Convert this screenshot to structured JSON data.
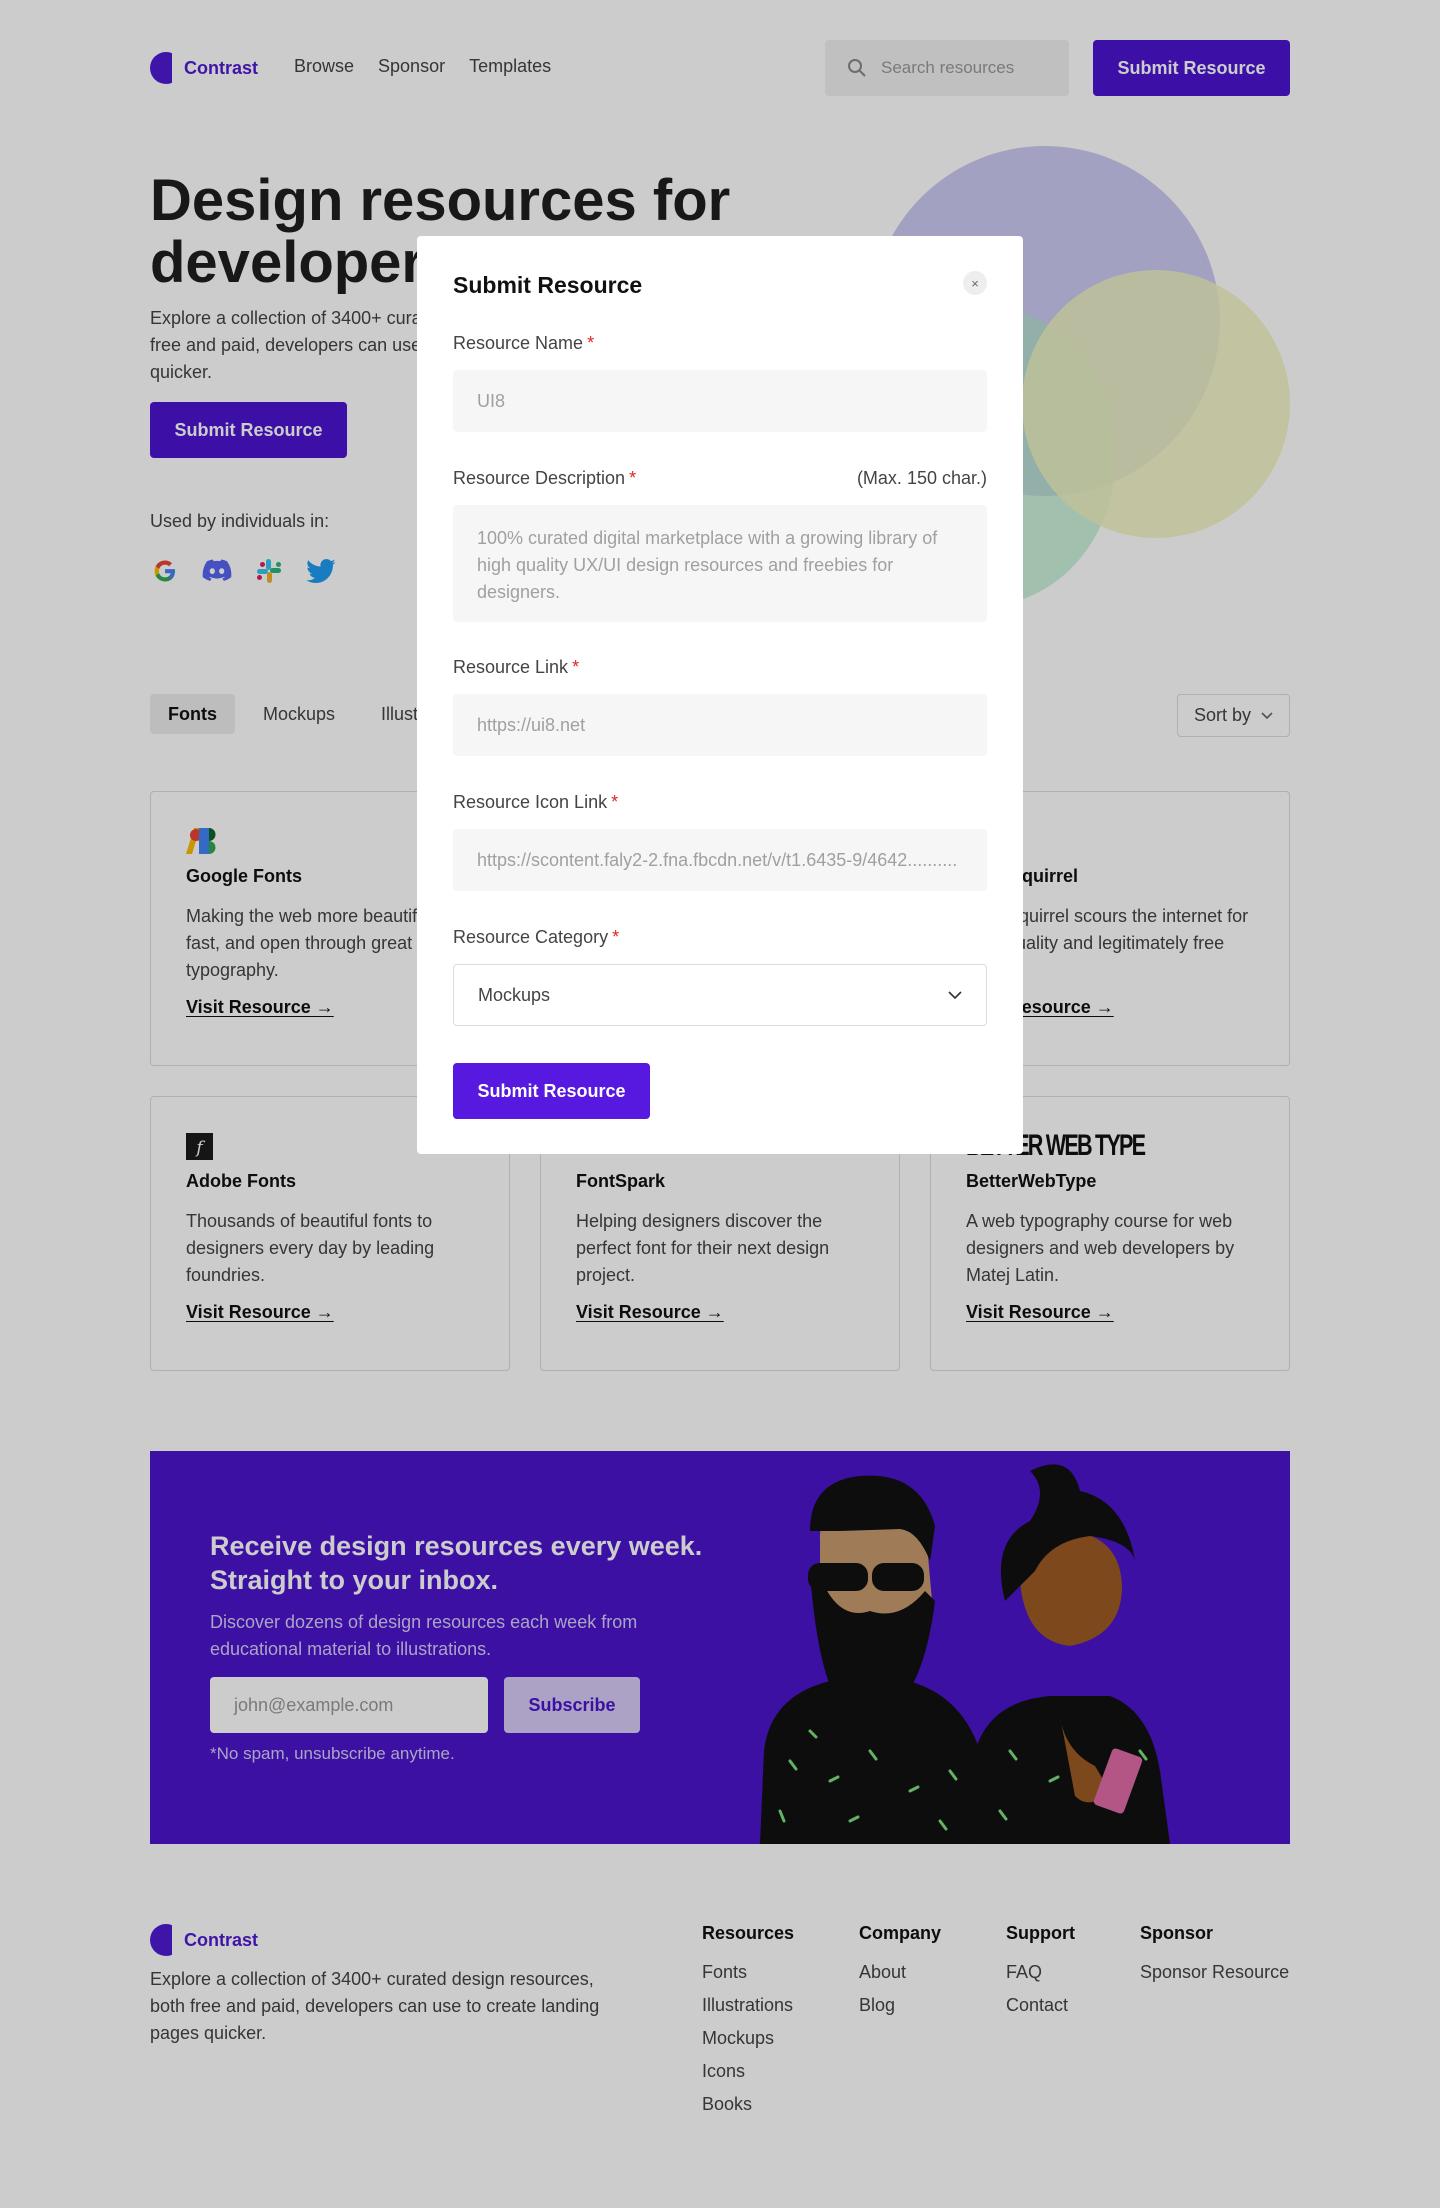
{
  "header": {
    "brand": "Contrast",
    "nav": [
      "Browse",
      "Sponsor",
      "Templates"
    ],
    "search_placeholder": "Search resources",
    "submit_label": "Submit Resource"
  },
  "hero": {
    "title": "Design resources for developers",
    "description": "Explore a collection of 3400+ curated design resources, both free and paid, developers can use to create landing pages quicker.",
    "button": "Submit Resource",
    "used_by": "Used by individuals in:",
    "brands": [
      "google-icon",
      "discord-icon",
      "slack-icon",
      "twitter-icon"
    ]
  },
  "filters": {
    "tabs": [
      "Fonts",
      "Mockups",
      "Illustrations"
    ],
    "active": "Fonts",
    "sort_label": "Sort by"
  },
  "cards": [
    {
      "title": "Google Fonts",
      "desc": "Making the web more beautiful, fast, and open through great typography.",
      "link": "Visit Resource →"
    },
    {
      "title": "",
      "desc": "",
      "link": ""
    },
    {
      "title": "Font Squirrel",
      "desc": "Font Squirrel scours the internet for high-quality and legitimately free fonts.",
      "link": "Visit Resource →"
    },
    {
      "title": "Adobe Fonts",
      "desc": "Thousands of beautiful fonts to designers every day by leading foundries.",
      "link": "Visit Resource →"
    },
    {
      "title": "FontSpark",
      "desc": "Helping designers discover the perfect font for their next design project.",
      "link": "Visit Resource →"
    },
    {
      "title": "BetterWebType",
      "desc": "A web typography course for web designers and web developers by Matej Latin.",
      "link": "Visit Resource →",
      "logo_text": "BETTER WEB TYPE"
    }
  ],
  "newsletter": {
    "title": "Receive design resources every week. Straight to your inbox.",
    "description": "Discover dozens of design resources each week from educational material to illustrations.",
    "email_placeholder": "john@example.com",
    "button": "Subscribe",
    "note": "*No spam, unsubscribe anytime."
  },
  "footer": {
    "brand": "Contrast",
    "description": "Explore a collection of 3400+ curated design resources, both free and paid, developers can use to create landing pages quicker.",
    "columns": [
      {
        "title": "Resources",
        "links": [
          "Fonts",
          "Illustrations",
          "Mockups",
          "Icons",
          "Books"
        ]
      },
      {
        "title": "Company",
        "links": [
          "About",
          "Blog"
        ]
      },
      {
        "title": "Support",
        "links": [
          "FAQ",
          "Contact"
        ]
      },
      {
        "title": "Sponsor",
        "links": [
          "Sponsor Resource"
        ]
      }
    ]
  },
  "modal": {
    "title": "Submit Resource",
    "close": "×",
    "required_mark": "*",
    "fields": {
      "name": {
        "label": "Resource Name",
        "placeholder": "UI8"
      },
      "description": {
        "label": "Resource Description",
        "hint": "(Max. 150 char.)",
        "placeholder": "100% curated digital marketplace with a growing library of high quality UX/UI design resources and freebies for designers."
      },
      "link": {
        "label": "Resource Link",
        "placeholder": "https://ui8.net"
      },
      "icon_link": {
        "label": "Resource Icon Link",
        "placeholder": "https://scontent.faly2-2.fna.fbcdn.net/v/t1.6435-9/4642.........."
      },
      "category": {
        "label": "Resource Category",
        "value": "Mockups"
      }
    },
    "submit": "Submit Resource"
  },
  "colors": {
    "accent": "#4c15d1",
    "overlay": "rgba(0,0,0,0.2)",
    "required": "#e02424"
  }
}
